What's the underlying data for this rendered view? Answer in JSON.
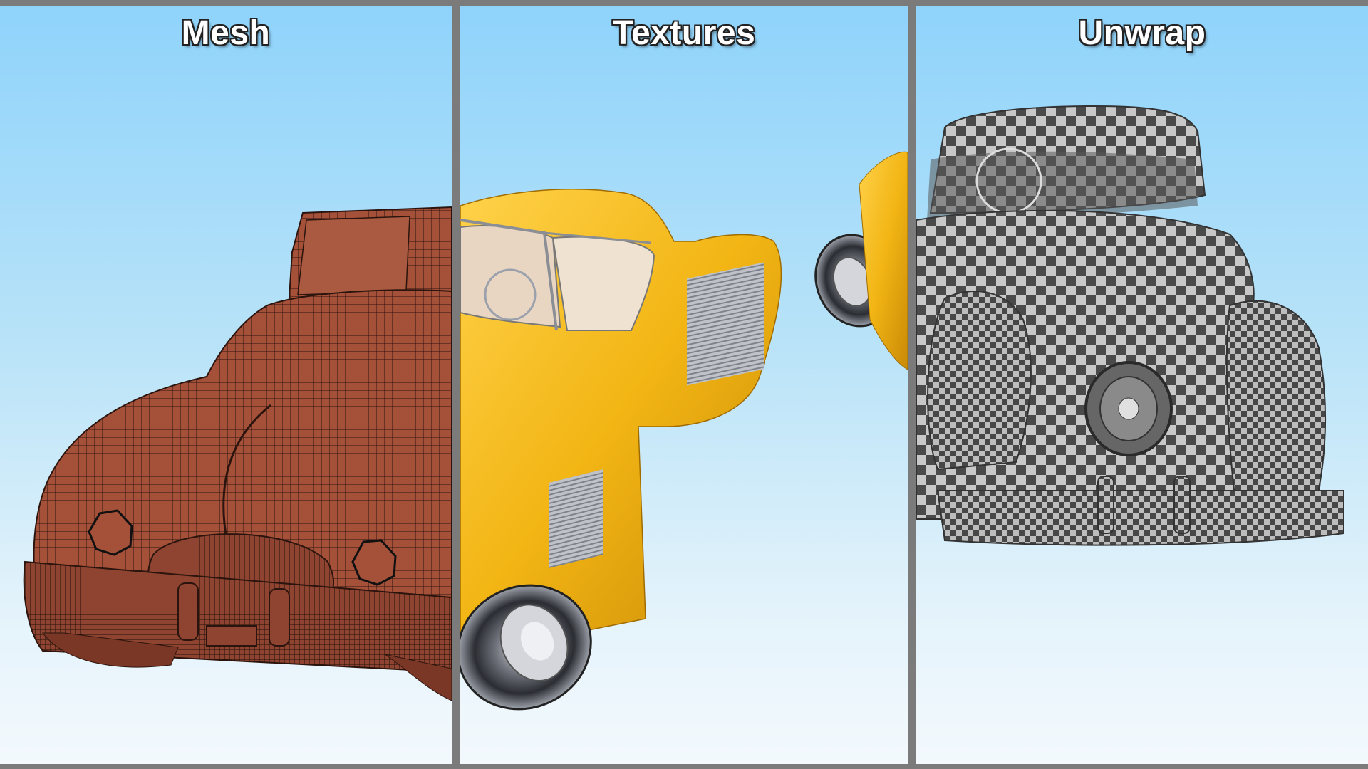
{
  "panels": {
    "mesh": {
      "title": "Mesh",
      "body_color": "#a5513a",
      "wire_color": "#2b140d"
    },
    "textures": {
      "title": "Textures",
      "body_color": "#f2b514",
      "chrome_color": "#9aa1ad"
    },
    "unwrap": {
      "title": "Unwrap",
      "light_check": "#c8c8c8",
      "dark_check": "#4a4a4a"
    }
  },
  "colors": {
    "sky_top": "#8fd3fb",
    "sky_bottom": "#f3f9fd",
    "divider": "#7b7b7b"
  }
}
